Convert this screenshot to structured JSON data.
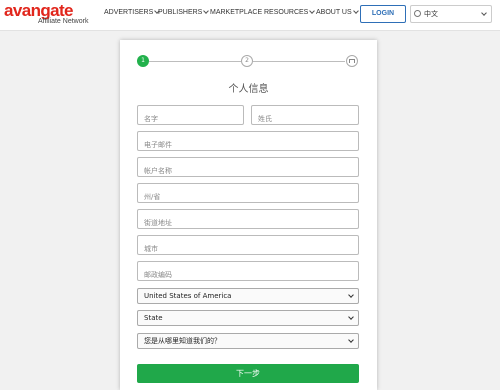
{
  "brand": {
    "name": "avangate",
    "subtitle": "Affiliate Network"
  },
  "nav": [
    {
      "label": "ADVERTISERS",
      "dropdown": true
    },
    {
      "label": "PUBLISHERS",
      "dropdown": true
    },
    {
      "label": "MARKETPLACE",
      "dropdown": false
    },
    {
      "label": "RESOURCES",
      "dropdown": true
    },
    {
      "label": "ABOUT US",
      "dropdown": true
    }
  ],
  "login_label": "LOGIN",
  "language": {
    "selected": "中文"
  },
  "steps": {
    "step1": "1",
    "step2": "2",
    "active": 1
  },
  "form": {
    "title": "个人信息",
    "first_name_placeholder": "名字",
    "last_name_placeholder": "姓氏",
    "email_placeholder": "电子邮件",
    "account_name_placeholder": "帐户名称",
    "province_placeholder": "州/省",
    "street_placeholder": "街道地址",
    "city_placeholder": "城市",
    "postal_placeholder": "邮政编码",
    "country_selected": "United States of America",
    "state_selected": "State",
    "referral_selected": "您是从哪里知道我们的？",
    "next_label": "下一步"
  },
  "colors": {
    "brand_red": "#e1261c",
    "accent_green": "#22b14c",
    "link_blue": "#2e6fb7"
  }
}
